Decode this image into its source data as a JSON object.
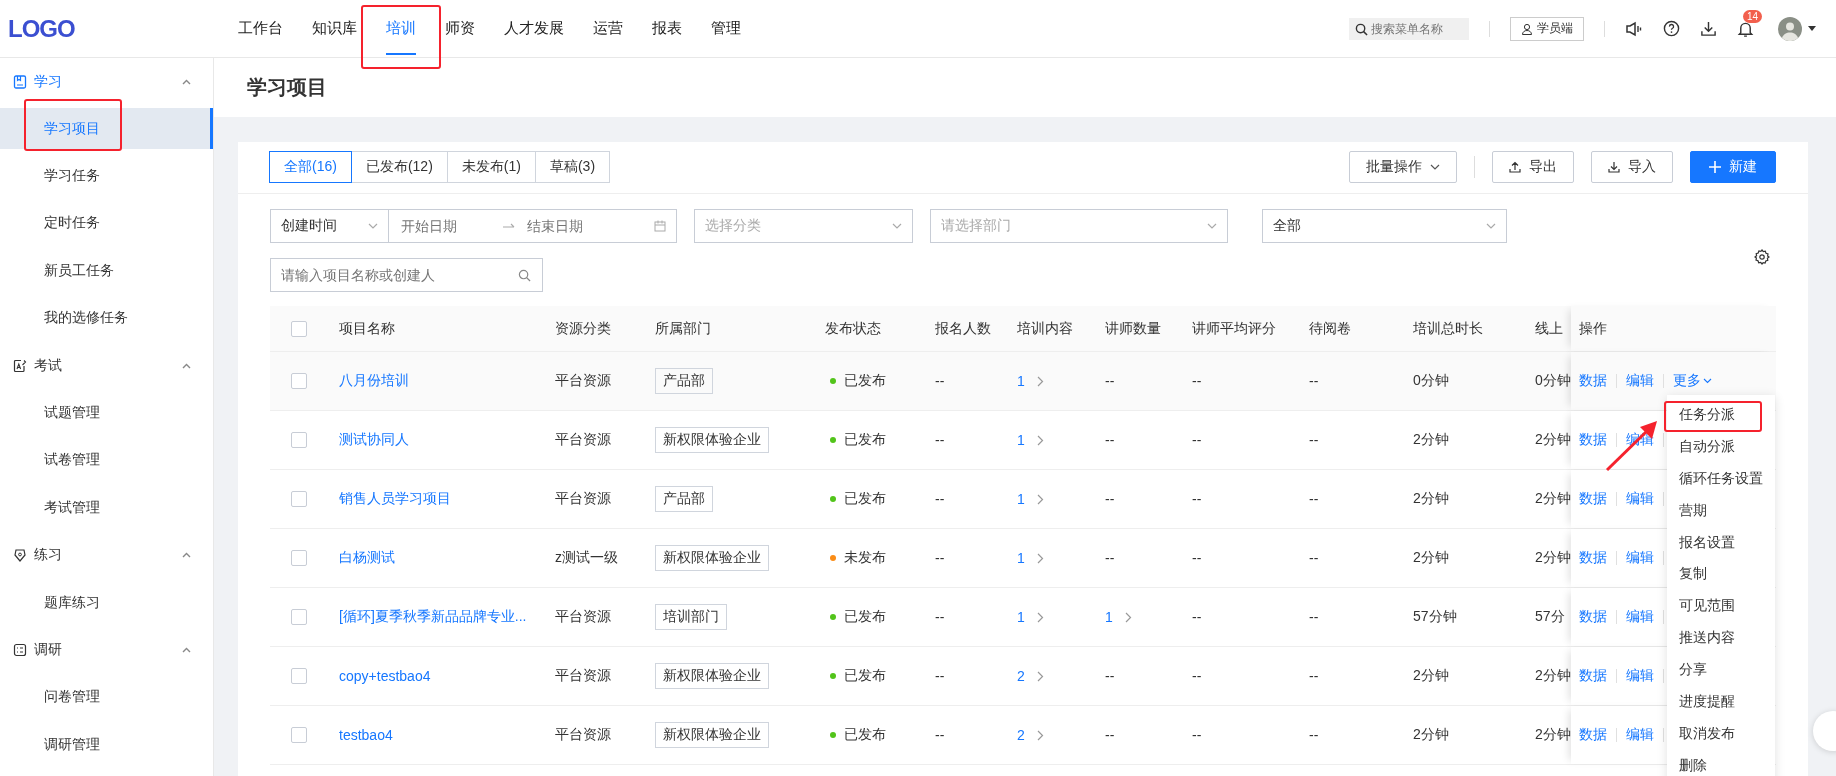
{
  "header": {
    "logo": "LOGO",
    "nav": [
      {
        "label": "工作台",
        "selected": false,
        "highlighted": false
      },
      {
        "label": "知识库",
        "selected": false,
        "highlighted": false
      },
      {
        "label": "培训",
        "selected": true,
        "highlighted": true
      },
      {
        "label": "师资",
        "selected": false,
        "highlighted": false
      },
      {
        "label": "人才发展",
        "selected": false,
        "highlighted": false
      },
      {
        "label": "运营",
        "selected": false,
        "highlighted": false
      },
      {
        "label": "报表",
        "selected": false,
        "highlighted": false
      },
      {
        "label": "管理",
        "selected": false,
        "highlighted": false
      }
    ],
    "search": {
      "placeholder": "搜索菜单名称"
    },
    "student_button": "学员端",
    "notification_badge": "14"
  },
  "sidebar": {
    "sections": [
      {
        "label": "学习",
        "expanded": true,
        "children": [
          {
            "label": "学习项目",
            "selected": true,
            "highlighted": true
          },
          {
            "label": "学习任务",
            "selected": false,
            "highlighted": false
          },
          {
            "label": "定时任务",
            "selected": false,
            "highlighted": false
          },
          {
            "label": "新员工任务",
            "selected": false,
            "highlighted": false
          },
          {
            "label": "我的选修任务",
            "selected": false,
            "highlighted": false
          }
        ]
      },
      {
        "label": "考试",
        "expanded": true,
        "children": [
          {
            "label": "试题管理",
            "selected": false,
            "highlighted": false
          },
          {
            "label": "试卷管理",
            "selected": false,
            "highlighted": false
          },
          {
            "label": "考试管理",
            "selected": false,
            "highlighted": false
          }
        ]
      },
      {
        "label": "练习",
        "expanded": true,
        "children": [
          {
            "label": "题库练习",
            "selected": false,
            "highlighted": false
          }
        ]
      },
      {
        "label": "调研",
        "expanded": true,
        "children": [
          {
            "label": "问卷管理",
            "selected": false,
            "highlighted": false
          },
          {
            "label": "调研管理",
            "selected": false,
            "highlighted": false
          }
        ]
      }
    ]
  },
  "page_title": "学习项目",
  "tabs": [
    {
      "label": "全部(16)",
      "selected": true
    },
    {
      "label": "已发布(12)",
      "selected": false
    },
    {
      "label": "未发布(1)",
      "selected": false
    },
    {
      "label": "草稿(3)",
      "selected": false
    }
  ],
  "toolbar": {
    "batch": "批量操作",
    "export": "导出",
    "import": "导入",
    "create": "新建"
  },
  "filters": {
    "time_type": "创建时间",
    "start_placeholder": "开始日期",
    "end_placeholder": "结束日期",
    "category_placeholder": "选择分类",
    "department_placeholder": "请选择部门",
    "status_value": "全部",
    "search_placeholder": "请输入项目名称或创建人"
  },
  "table": {
    "header_checked": false,
    "columns": [
      "项目名称",
      "资源分类",
      "所属部门",
      "发布状态",
      "报名人数",
      "培训内容",
      "讲师数量",
      "讲师平均评分",
      "待阅卷",
      "培训总时长",
      "线上",
      "操作"
    ],
    "rows": [
      {
        "checked": false,
        "hovered": true,
        "name": "八月份培训",
        "category": "平台资源",
        "department": "产品部",
        "status": {
          "label": "已发布",
          "color": "#52c41a"
        },
        "enrollment": "--",
        "content": {
          "text": "1",
          "link": true
        },
        "lecturers": {
          "text": "--",
          "link": false
        },
        "rating": "--",
        "pending": "--",
        "duration": "0分钟",
        "online": "0分钟",
        "actions": [
          {
            "label": "数据",
            "kind": "link"
          },
          {
            "label": "编辑",
            "kind": "link"
          },
          {
            "label": "更多",
            "kind": "dropdown"
          }
        ]
      },
      {
        "checked": false,
        "hovered": false,
        "name": "测试协同人",
        "category": "平台资源",
        "department": "新权限体验企业",
        "status": {
          "label": "已发布",
          "color": "#52c41a"
        },
        "enrollment": "--",
        "content": {
          "text": "1",
          "link": true
        },
        "lecturers": {
          "text": "--",
          "link": false
        },
        "rating": "--",
        "pending": "--",
        "duration": "2分钟",
        "online": "2分钟",
        "actions": [
          {
            "label": "数据",
            "kind": "link"
          },
          {
            "label": "编辑",
            "kind": "link"
          }
        ]
      },
      {
        "checked": false,
        "hovered": false,
        "name": "销售人员学习项目",
        "category": "平台资源",
        "department": "产品部",
        "status": {
          "label": "已发布",
          "color": "#52c41a"
        },
        "enrollment": "--",
        "content": {
          "text": "1",
          "link": true
        },
        "lecturers": {
          "text": "--",
          "link": false
        },
        "rating": "--",
        "pending": "--",
        "duration": "2分钟",
        "online": "2分钟",
        "actions": [
          {
            "label": "数据",
            "kind": "link"
          },
          {
            "label": "编辑",
            "kind": "link"
          }
        ]
      },
      {
        "checked": false,
        "hovered": false,
        "name": "白杨测试",
        "category": "z测试一级",
        "department": "新权限体验企业",
        "status": {
          "label": "未发布",
          "color": "#fa8c16"
        },
        "enrollment": "--",
        "content": {
          "text": "1",
          "link": true
        },
        "lecturers": {
          "text": "--",
          "link": false
        },
        "rating": "--",
        "pending": "--",
        "duration": "2分钟",
        "online": "2分钟",
        "actions": [
          {
            "label": "数据",
            "kind": "link"
          },
          {
            "label": "编辑",
            "kind": "link"
          }
        ]
      },
      {
        "checked": false,
        "hovered": false,
        "name": "[循环]夏季秋季新品品牌专业...",
        "category": "平台资源",
        "department": "培训部门",
        "status": {
          "label": "已发布",
          "color": "#52c41a"
        },
        "enrollment": "--",
        "content": {
          "text": "1",
          "link": true
        },
        "lecturers": {
          "text": "1",
          "link": true
        },
        "rating": "--",
        "pending": "--",
        "duration": "57分钟",
        "online": "57分",
        "actions": [
          {
            "label": "数据",
            "kind": "link"
          },
          {
            "label": "编辑",
            "kind": "link"
          }
        ]
      },
      {
        "checked": false,
        "hovered": false,
        "name": "copy+testbao4",
        "category": "平台资源",
        "department": "新权限体验企业",
        "status": {
          "label": "已发布",
          "color": "#52c41a"
        },
        "enrollment": "--",
        "content": {
          "text": "2",
          "link": true
        },
        "lecturers": {
          "text": "--",
          "link": false
        },
        "rating": "--",
        "pending": "--",
        "duration": "2分钟",
        "online": "2分钟",
        "actions": [
          {
            "label": "数据",
            "kind": "link"
          },
          {
            "label": "编辑",
            "kind": "link"
          }
        ]
      },
      {
        "checked": false,
        "hovered": false,
        "name": "testbao4",
        "category": "平台资源",
        "department": "新权限体验企业",
        "status": {
          "label": "已发布",
          "color": "#52c41a"
        },
        "enrollment": "--",
        "content": {
          "text": "2",
          "link": true
        },
        "lecturers": {
          "text": "--",
          "link": false
        },
        "rating": "--",
        "pending": "--",
        "duration": "2分钟",
        "online": "2分钟",
        "actions": [
          {
            "label": "数据",
            "kind": "link"
          },
          {
            "label": "编辑",
            "kind": "link"
          }
        ]
      }
    ]
  },
  "more_menu": {
    "items": [
      {
        "label": "任务分派",
        "highlighted": true
      },
      {
        "label": "自动分派",
        "highlighted": false
      },
      {
        "label": "循环任务设置",
        "highlighted": false
      },
      {
        "label": "营期",
        "highlighted": false
      },
      {
        "label": "报名设置",
        "highlighted": false
      },
      {
        "label": "复制",
        "highlighted": false
      },
      {
        "label": "可见范围",
        "highlighted": false
      },
      {
        "label": "推送内容",
        "highlighted": false
      },
      {
        "label": "分享",
        "highlighted": false
      },
      {
        "label": "进度提醒",
        "highlighted": false
      },
      {
        "label": "取消发布",
        "highlighted": false
      },
      {
        "label": "删除",
        "highlighted": false
      }
    ]
  }
}
